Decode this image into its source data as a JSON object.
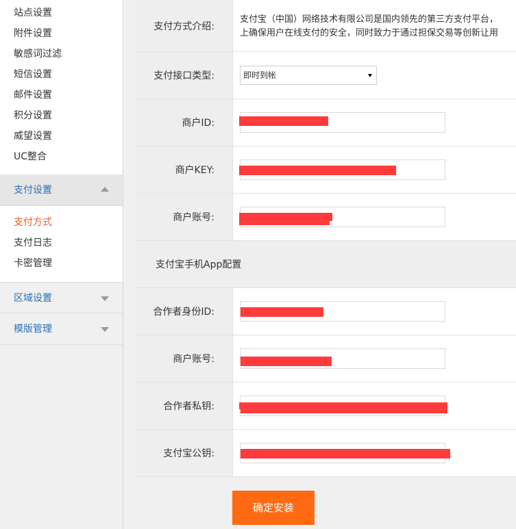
{
  "sidebar": {
    "top_items": [
      "站点设置",
      "附件设置",
      "敏感词过滤",
      "短信设置",
      "邮件设置",
      "积分设置",
      "威望设置",
      "UC整合"
    ],
    "pay_section": {
      "title": "支付设置",
      "items": [
        "支付方式",
        "支付日志",
        "卡密管理"
      ],
      "active": "支付方式"
    },
    "collapsed_sections": [
      "区域设置",
      "模版管理"
    ]
  },
  "form": {
    "intro_label": "支付方式介绍:",
    "intro_line1": "支付宝（中国）网络技术有限公司是国内领先的第三方支付平台，",
    "intro_line2": "上确保用户在线支付的安全，同时致力于通过担保交易等创新让用",
    "interface_label": "支付接口类型:",
    "interface_value": "即时到帐",
    "merchant_id_label": "商户ID:",
    "merchant_key_label": "商户KEY:",
    "merchant_account_label": "商户账号:",
    "app_section_title": "支付宝手机App配置",
    "partner_id_label": "合作者身份ID:",
    "app_account_label": "商户账号:",
    "private_key_label": "合作者私钥:",
    "public_key_label": "支付宝公钥:"
  },
  "submit_label": "确定安装",
  "colors": {
    "accent": "#ff6a12",
    "link": "#2a6fb8",
    "active": "#f05a1a",
    "redaction": "#ff3b3b"
  }
}
